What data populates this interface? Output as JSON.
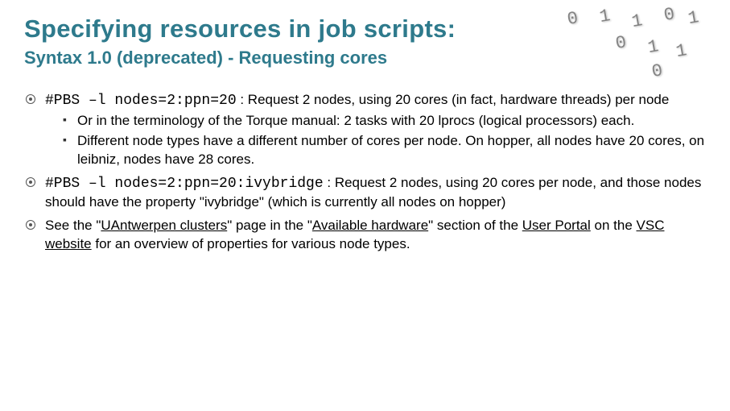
{
  "header": {
    "title": "Specifying resources in job scripts:",
    "subtitle": "Syntax 1.0 (deprecated) - Requesting cores"
  },
  "logo": {
    "glyphs": [
      "0",
      "1",
      "1",
      "0",
      "1",
      "0",
      "1",
      "1",
      "0"
    ]
  },
  "bullets": [
    {
      "code": "#PBS –l nodes=2:ppn=20",
      "after_code": " : Request 2 nodes, using 20 cores (in fact, hardware threads) per node",
      "sub": [
        "Or in the terminology of the Torque manual: 2 tasks with 20 lprocs (logical processors) each.",
        "Different node types have a different number of cores per node. On hopper, all nodes have 20 cores, on leibniz, nodes have 28 cores."
      ]
    },
    {
      "code": "#PBS –l nodes=2:ppn=20:ivybridge",
      "after_code": " : Request 2 nodes, using 20 cores per node, and those nodes should have the property \"ivybridge\" (which is currently all nodes on hopper)"
    },
    {
      "pre": "See the \"",
      "link1": "UAntwerpen clusters",
      "mid1": "\" page in the \"",
      "link2": "Available hardware",
      "mid2": "\" section of the ",
      "link3": "User Portal",
      "mid3": " on the ",
      "link4": "VSC website",
      "post": " for an overview of properties for various node types."
    }
  ]
}
